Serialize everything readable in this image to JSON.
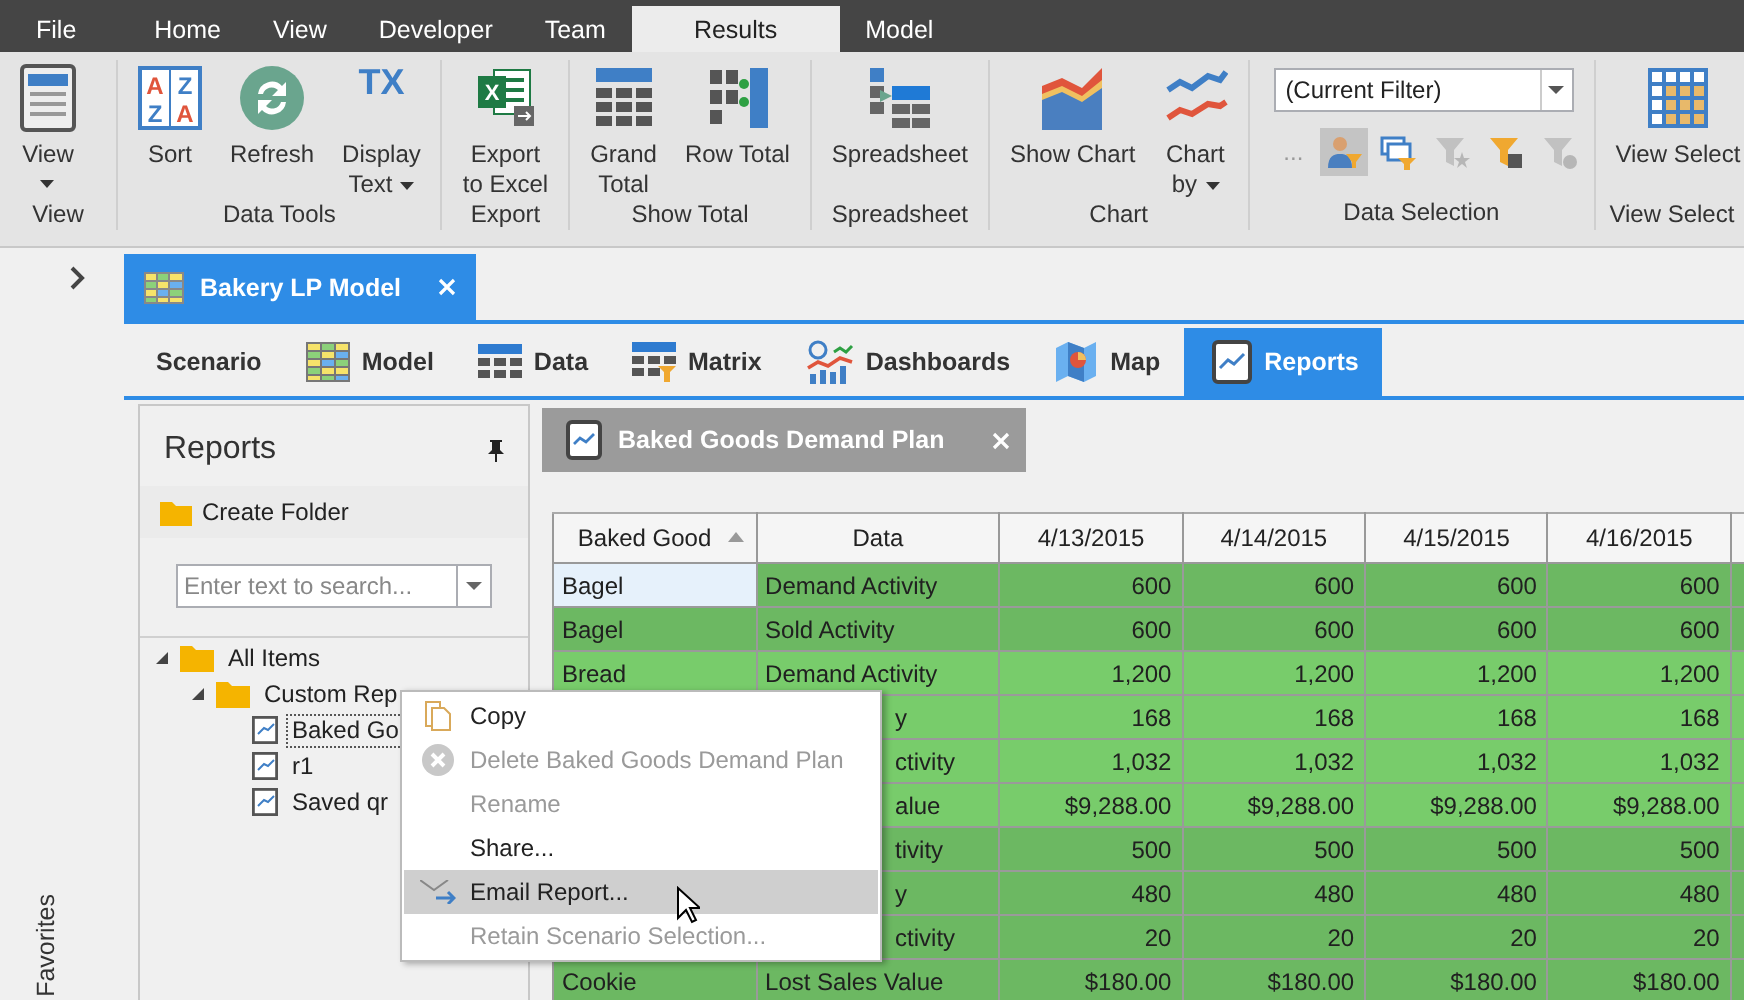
{
  "menu_tabs": [
    {
      "label": "File",
      "selected": false
    },
    {
      "label": "Home",
      "selected": false
    },
    {
      "label": "View",
      "selected": false
    },
    {
      "label": "Developer",
      "selected": false
    },
    {
      "label": "Team",
      "selected": false
    },
    {
      "label": "Results",
      "selected": true
    },
    {
      "label": "Model",
      "selected": false
    }
  ],
  "ribbon_groups": [
    {
      "label": "View",
      "buttons": [
        {
          "lines": [
            "View"
          ],
          "dropdown": true
        }
      ]
    },
    {
      "label": "Data Tools",
      "buttons": [
        {
          "lines": [
            "Sort"
          ],
          "dropdown": false,
          "icon_text": [
            "A",
            "Z",
            "Z",
            "A"
          ]
        },
        {
          "lines": [
            "Refresh"
          ],
          "dropdown": false
        },
        {
          "lines": [
            "Display",
            "Text"
          ],
          "dropdown": true,
          "icon_text": [
            "TX"
          ]
        }
      ]
    },
    {
      "label": "Export",
      "buttons": [
        {
          "lines": [
            "Export",
            "to Excel"
          ],
          "dropdown": false,
          "icon_text": [
            "X"
          ]
        }
      ]
    },
    {
      "label": "Show Total",
      "buttons": [
        {
          "lines": [
            "Grand",
            "Total"
          ],
          "dropdown": false
        },
        {
          "lines": [
            "Row Total"
          ],
          "dropdown": false
        }
      ]
    },
    {
      "label": "Spreadsheet",
      "buttons": [
        {
          "lines": [
            "Spreadsheet"
          ],
          "dropdown": false
        }
      ]
    },
    {
      "label": "Chart",
      "buttons": [
        {
          "lines": [
            "Show Chart"
          ],
          "dropdown": false
        },
        {
          "lines": [
            "Chart",
            "by"
          ],
          "dropdown": true
        }
      ]
    },
    {
      "label": "Data Selection",
      "filter": "(Current Filter)",
      "more": "...",
      "tools": [
        {
          "selected": true,
          "disabled": false
        },
        {
          "selected": false,
          "disabled": false
        },
        {
          "selected": false,
          "disabled": true
        },
        {
          "selected": false,
          "disabled": false
        },
        {
          "selected": false,
          "disabled": true
        }
      ]
    },
    {
      "label": "View Select",
      "buttons": [
        {
          "lines": [
            "View Select"
          ],
          "dropdown": false
        }
      ]
    }
  ],
  "sidebar": {
    "label": "Favorites"
  },
  "document_tab": {
    "title": "Bakery LP Model"
  },
  "nav_tabs": [
    {
      "label": "Scenario",
      "selected": false
    },
    {
      "label": "Model",
      "selected": false
    },
    {
      "label": "Data",
      "selected": false
    },
    {
      "label": "Matrix",
      "selected": false
    },
    {
      "label": "Dashboards",
      "selected": false
    },
    {
      "label": "Map",
      "selected": false
    },
    {
      "label": "Reports",
      "selected": true
    }
  ],
  "reports_panel": {
    "title": "Reports",
    "create_folder": "Create Folder",
    "search": {
      "placeholder": "Enter text to search..."
    },
    "tree": [
      {
        "kind": "folder",
        "label": "All Items",
        "expanded": true,
        "children": [
          {
            "kind": "folder",
            "label": "Custom Rep",
            "expanded": true,
            "children": [
              {
                "kind": "report",
                "label": "Baked Go",
                "focused": true
              },
              {
                "kind": "report",
                "label": "r1",
                "focused": false
              },
              {
                "kind": "report",
                "label": "Saved qr",
                "focused": false
              }
            ]
          }
        ]
      }
    ]
  },
  "report_tab": {
    "title": "Baked Goods Demand Plan"
  },
  "table": {
    "columns": [
      "Baked Good",
      "Data",
      "4/13/2015",
      "4/14/2015",
      "4/15/2015",
      "4/16/2015"
    ],
    "rows": [
      {
        "color": "#6cb862",
        "selected": true,
        "baked_good": "Bagel",
        "data": "Demand Activity",
        "data_partial": false,
        "values": [
          "600",
          "600",
          "600",
          "600"
        ]
      },
      {
        "color": "#6cb862",
        "selected": false,
        "baked_good": "Bagel",
        "data": "Sold Activity",
        "data_partial": false,
        "values": [
          "600",
          "600",
          "600",
          "600"
        ]
      },
      {
        "color": "#78cc6b",
        "selected": false,
        "baked_good": "Bread",
        "data": "Demand Activity",
        "data_partial": false,
        "values": [
          "1,200",
          "1,200",
          "1,200",
          "1,200"
        ]
      },
      {
        "color": "#78cc6b",
        "data": "y",
        "data_partial": true,
        "values": [
          "168",
          "168",
          "168",
          "168"
        ]
      },
      {
        "color": "#78cc6b",
        "data": "ctivity",
        "data_partial": true,
        "values": [
          "1,032",
          "1,032",
          "1,032",
          "1,032"
        ]
      },
      {
        "color": "#78cc6b",
        "data": "alue",
        "data_partial": true,
        "values": [
          "$9,288.00",
          "$9,288.00",
          "$9,288.00",
          "$9,288.00"
        ]
      },
      {
        "color": "#6cb862",
        "data": "tivity",
        "data_partial": true,
        "values": [
          "500",
          "500",
          "500",
          "500"
        ]
      },
      {
        "color": "#6cb862",
        "data": "y",
        "data_partial": true,
        "values": [
          "480",
          "480",
          "480",
          "480"
        ]
      },
      {
        "color": "#6cb862",
        "data": "ctivity",
        "data_partial": true,
        "values": [
          "20",
          "20",
          "20",
          "20"
        ]
      },
      {
        "color": "#6cb862",
        "selected": false,
        "baked_good": "Cookie",
        "data": "Lost Sales Value",
        "data_partial": false,
        "values": [
          "$180.00",
          "$180.00",
          "$180.00",
          "$180.00"
        ]
      }
    ]
  },
  "context_menu": [
    {
      "label": "Copy",
      "disabled": false,
      "highlighted": false
    },
    {
      "label": "Delete Baked Goods Demand Plan",
      "disabled": true,
      "highlighted": false
    },
    {
      "label": "Rename",
      "disabled": true,
      "highlighted": false
    },
    {
      "label": "Share...",
      "disabled": false,
      "highlighted": false
    },
    {
      "label": "Email Report...",
      "disabled": false,
      "highlighted": true
    },
    {
      "label": "Retain Scenario Selection...",
      "disabled": true,
      "highlighted": false
    }
  ]
}
